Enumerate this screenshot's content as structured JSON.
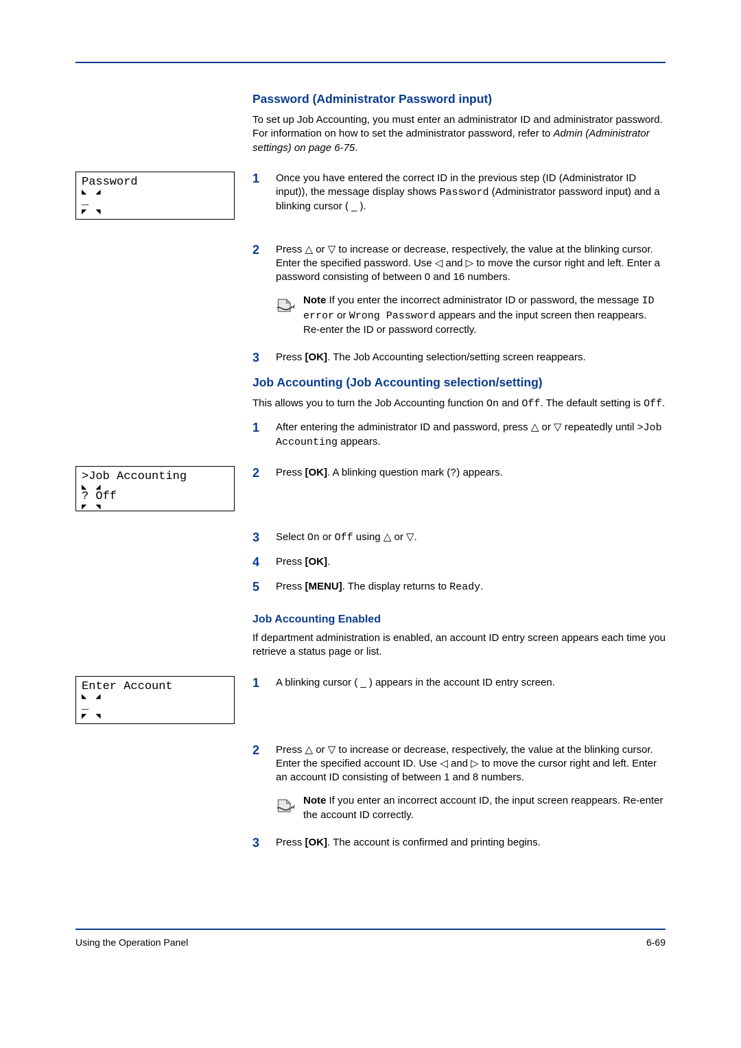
{
  "section1": {
    "title": "Password (Administrator Password input)",
    "intro_a": "To set up Job Accounting, you must enter an administrator ID and administrator password. For information on how to set the administrator password, refer to ",
    "intro_link": "Admin (Administrator settings) on page 6-75",
    "intro_c": ".",
    "lcd_line1": "Password",
    "lcd_line2": "_",
    "step1_a": "Once you have entered the correct ID in the previous step (ID (Administrator ID input)), the message display shows ",
    "step1_code": "Password",
    "step1_b": " (Administrator password input) and a blinking cursor ( _ ).",
    "step2": "Press △ or ▽ to increase or decrease, respectively, the value at the blinking cursor. Enter the specified password. Use ◁ and ▷ to move the cursor right and left. Enter a password consisting of between 0 and 16 numbers.",
    "note_label": "Note",
    "note_a": "  If you enter the incorrect administrator ID or password, the message ",
    "note_code1": "ID error",
    "note_b": " or ",
    "note_code2": "Wrong Password",
    "note_c": " appears and the input screen then reappears. Re-enter the ID or password correctly.",
    "step3_a": "Press ",
    "step3_ok": "[OK]",
    "step3_b": ". The Job Accounting selection/setting screen reappears."
  },
  "section2": {
    "title": "Job Accounting (Job Accounting selection/setting)",
    "intro_a": "This allows you to turn the Job Accounting function ",
    "on": "On",
    "and": " and ",
    "off": "Off",
    "intro_b": ". The default setting is ",
    "off2": "Off",
    "intro_c": ".",
    "step1_a": "After entering the administrator ID and password, press △ or ▽ repeatedly until ",
    "step1_code": ">Job Accounting",
    "step1_b": " appears.",
    "lcd_line1": ">Job Accounting",
    "lcd_line2": "? Off",
    "step2_a": "Press ",
    "step2_ok": "[OK]",
    "step2_b": ". A blinking question mark (",
    "step2_q": "?",
    "step2_c": ") appears.",
    "step3_a": "Select ",
    "step3_on": "On",
    "step3_or": " or ",
    "step3_off": "Off",
    "step3_b": " using △ or ▽.",
    "step4_a": "Press ",
    "step4_ok": "[OK]",
    "step4_b": ".",
    "step5_a": "Press ",
    "step5_menu": "[MENU]",
    "step5_b": ". The display returns to ",
    "step5_ready": "Ready",
    "step5_c": "."
  },
  "section3": {
    "title": "Job Accounting Enabled",
    "intro": "If department administration is enabled, an account ID entry screen appears each time you retrieve a status page or list.",
    "lcd_line1": "Enter Account",
    "lcd_line2": "_",
    "step1": "A blinking cursor ( _ ) appears in the account ID entry screen.",
    "step2": "Press △ or ▽ to increase or decrease, respectively, the value at the blinking cursor. Enter the specified account ID. Use ◁ and ▷ to move the cursor right and left. Enter an account ID consisting of between 1 and 8 numbers.",
    "note_label": "Note",
    "note": "  If you enter an incorrect account ID,  the input screen reappears. Re-enter the account ID correctly.",
    "step3_a": "Press ",
    "step3_ok": "[OK]",
    "step3_b": ". The account is confirmed and printing begins."
  },
  "footer": {
    "left": "Using the Operation Panel",
    "right": "6-69"
  }
}
